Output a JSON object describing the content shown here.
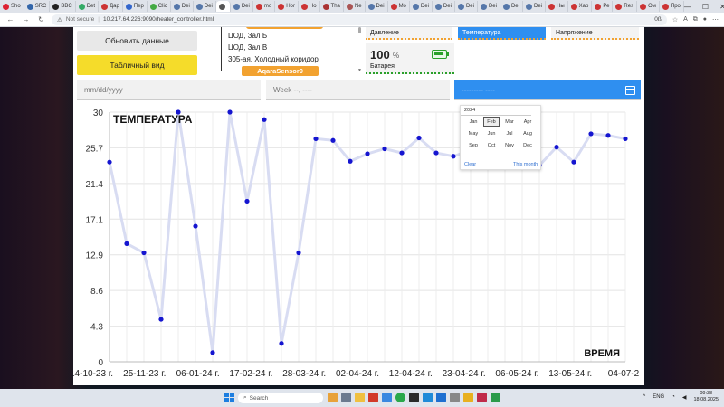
{
  "browser": {
    "tabs": [
      {
        "label": "Sho",
        "color": "#d23"
      },
      {
        "label": "SRC",
        "color": "#36a"
      },
      {
        "label": "BBC",
        "color": "#222"
      },
      {
        "label": "Det",
        "color": "#3a6"
      },
      {
        "label": "Дар",
        "color": "#c33"
      },
      {
        "label": "Пер",
        "color": "#36c"
      },
      {
        "label": "Clic",
        "color": "#4a4"
      },
      {
        "label": "Dei",
        "color": "#57a"
      },
      {
        "label": "Dei",
        "color": "#57a"
      },
      {
        "label": "",
        "color": "#555"
      },
      {
        "label": "Dei",
        "color": "#57a"
      },
      {
        "label": "mo",
        "color": "#c33"
      },
      {
        "label": "Hor",
        "color": "#c33"
      },
      {
        "label": "Ho",
        "color": "#c33"
      },
      {
        "label": "Tha",
        "color": "#a33"
      },
      {
        "label": "Ne",
        "color": "#a55"
      },
      {
        "label": "Dei",
        "color": "#57a"
      },
      {
        "label": "Mo",
        "color": "#c33"
      },
      {
        "label": "Dei",
        "color": "#57a"
      },
      {
        "label": "Dei",
        "color": "#57a"
      },
      {
        "label": "Dei",
        "color": "#57a"
      },
      {
        "label": "Dei",
        "color": "#57a"
      },
      {
        "label": "Dei",
        "color": "#57a"
      },
      {
        "label": "Dei",
        "color": "#57a"
      },
      {
        "label": "Ны",
        "color": "#c33"
      },
      {
        "label": "Хар",
        "color": "#c33"
      },
      {
        "label": "Ре",
        "color": "#c33"
      },
      {
        "label": "Res",
        "color": "#c33"
      },
      {
        "label": "Ом",
        "color": "#c33"
      },
      {
        "label": "Про",
        "color": "#c33"
      }
    ],
    "url_security": "Not secure",
    "url": "10.217.64.226:9090/heater_controller.html",
    "zoom": "0ß"
  },
  "controls": {
    "refresh_label": "Обновить данные",
    "table_label": "Табличный вид"
  },
  "sensors": {
    "items": [
      "ЦОД, Зал Б",
      "ЦОД, Зал В",
      "305-ая, Холодный коридор"
    ],
    "tag": "AqaraSensor9"
  },
  "metrics": {
    "pressure": "Давление",
    "temperature": "Температура",
    "voltage": "Напряжение"
  },
  "battery": {
    "value": "100",
    "unit": "%",
    "label": "Батарея",
    "icon": "battery-icon"
  },
  "inputs": {
    "date_placeholder": "mm/dd/yyyy",
    "week_placeholder": "Week --, ----",
    "month_value": "--------- ----"
  },
  "month_picker": {
    "year": "2024",
    "months": [
      "Jan",
      "Feb",
      "Mar",
      "Apr",
      "May",
      "Jun",
      "Jul",
      "Aug",
      "Sep",
      "Oct",
      "Nov",
      "Dec"
    ],
    "selected": "Feb",
    "clear": "Clear",
    "this_month": "This month"
  },
  "chart_data": {
    "type": "line",
    "title": "ТЕМПЕРАТУРА",
    "xlabel": "ВРЕМЯ",
    "ylabel": "",
    "ylim": [
      0,
      30
    ],
    "yticks": [
      "0",
      "4.3",
      "8.6",
      "12.9",
      "17.1",
      "21.4",
      "25.7",
      "30"
    ],
    "xtick_labels": [
      "14-10-23 г.",
      "25-11-23 г.",
      "06-01-24 г.",
      "17-02-24 г.",
      "28-03-24 г.",
      "02-04-24 г.",
      "12-04-24 г.",
      "23-04-24 г.",
      "06-05-24 г.",
      "13-05-24 г.",
      "04-07-2"
    ],
    "series": [
      {
        "values": [
          24,
          14.2,
          13.1,
          5.1,
          30,
          16.3,
          1.1,
          30,
          19.3,
          29.1,
          2.2,
          13.1,
          26.8,
          26.6,
          24.1,
          25,
          25.6,
          25.1,
          26.9,
          25.1,
          24.7,
          25.4,
          25.6,
          26.5,
          25,
          23.6,
          25.8,
          24,
          27.4,
          27.2,
          26.8
        ]
      }
    ],
    "grid": true,
    "line_color": "#d8dcf2",
    "point_color": "#1515d0"
  },
  "taskbar": {
    "search_label": "Search",
    "lang": "ENG",
    "time": "09:38",
    "date": "18.08.2025"
  }
}
